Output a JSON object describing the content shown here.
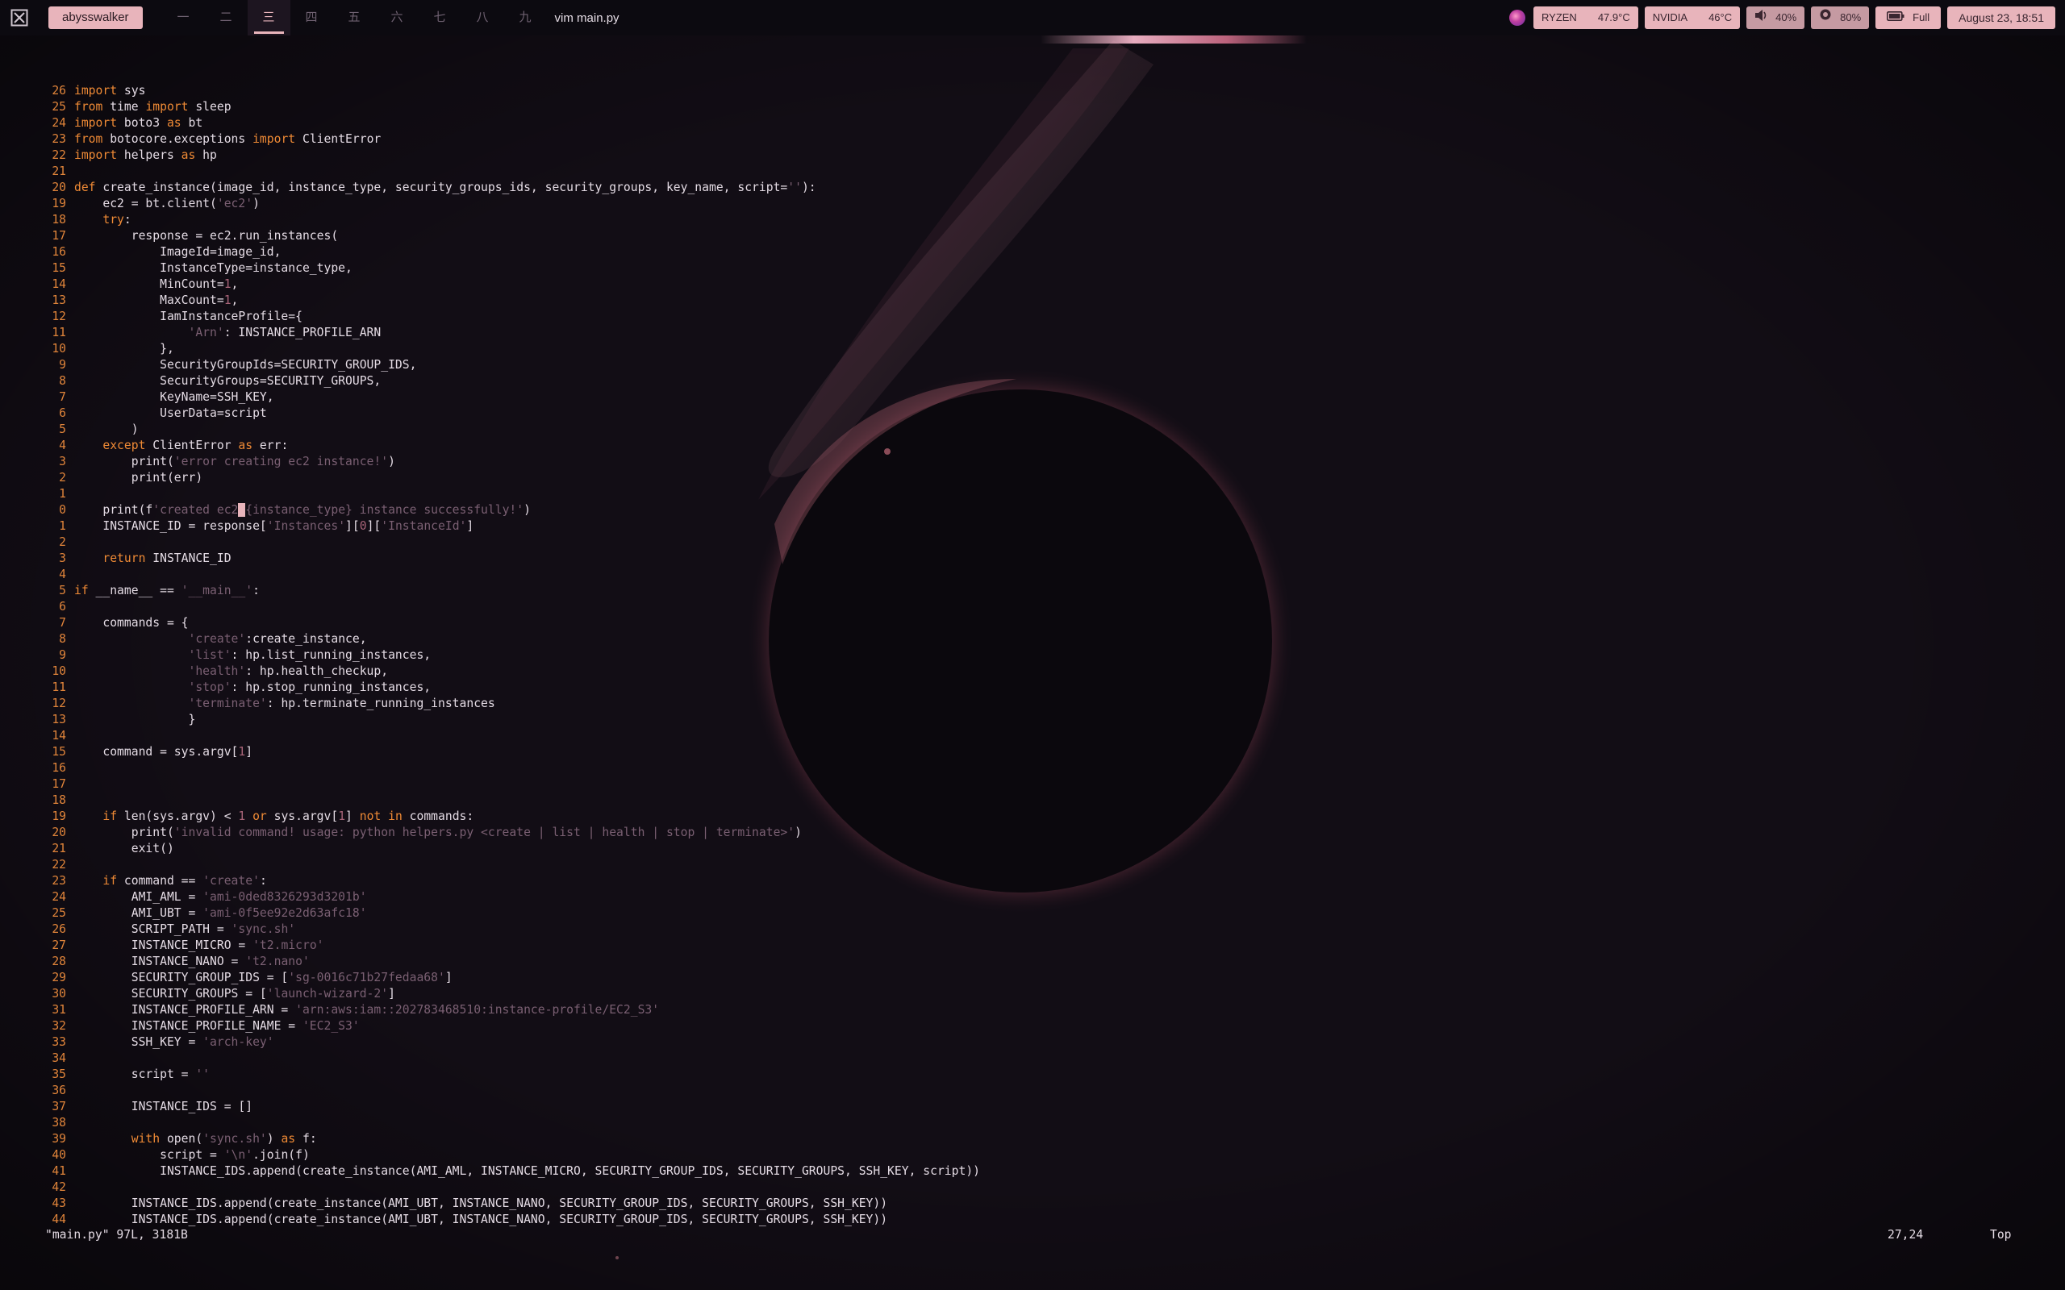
{
  "topbar": {
    "user": "abysswalker",
    "workspaces": [
      "一",
      "二",
      "三",
      "四",
      "五",
      "六",
      "七",
      "八",
      "九"
    ],
    "active_workspace": 2,
    "window_title": "vim main.py",
    "cpu_label": "RYZEN",
    "cpu_temp": "47.9°C",
    "gpu_label": "NVIDIA",
    "gpu_temp": "46°C",
    "volume": "40%",
    "brightness": "80%",
    "battery": "Full",
    "datetime": "August 23, 18:51"
  },
  "editor": {
    "lines": [
      {
        "n": "26",
        "t": "import sys"
      },
      {
        "n": "25",
        "t": "from time import sleep"
      },
      {
        "n": "24",
        "t": "import boto3 as bt"
      },
      {
        "n": "23",
        "t": "from botocore.exceptions import ClientError"
      },
      {
        "n": "22",
        "t": "import helpers as hp"
      },
      {
        "n": "21",
        "t": ""
      },
      {
        "n": "20",
        "t": "def create_instance(image_id, instance_type, security_groups_ids, security_groups, key_name, script=''):"
      },
      {
        "n": "19",
        "t": "    ec2 = bt.client('ec2')"
      },
      {
        "n": "18",
        "t": "    try:"
      },
      {
        "n": "17",
        "t": "        response = ec2.run_instances("
      },
      {
        "n": "16",
        "t": "            ImageId=image_id,"
      },
      {
        "n": "15",
        "t": "            InstanceType=instance_type,"
      },
      {
        "n": "14",
        "t": "            MinCount=1,"
      },
      {
        "n": "13",
        "t": "            MaxCount=1,"
      },
      {
        "n": "12",
        "t": "            IamInstanceProfile={"
      },
      {
        "n": "11",
        "t": "                'Arn': INSTANCE_PROFILE_ARN"
      },
      {
        "n": "10",
        "t": "            },"
      },
      {
        "n": "9",
        "t": "            SecurityGroupIds=SECURITY_GROUP_IDS,"
      },
      {
        "n": "8",
        "t": "            SecurityGroups=SECURITY_GROUPS,"
      },
      {
        "n": "7",
        "t": "            KeyName=SSH_KEY,"
      },
      {
        "n": "6",
        "t": "            UserData=script"
      },
      {
        "n": "5",
        "t": "        )"
      },
      {
        "n": "4",
        "t": "    except ClientError as err:"
      },
      {
        "n": "3",
        "t": "        print('error creating ec2 instance!')"
      },
      {
        "n": "2",
        "t": "        print(err)"
      },
      {
        "n": "1",
        "t": ""
      },
      {
        "n": "0",
        "t": "    print(f'created ec2 {instance_type} instance successfully!')"
      },
      {
        "n": "1",
        "t": "    INSTANCE_ID = response['Instances'][0]['InstanceId']"
      },
      {
        "n": "2",
        "t": ""
      },
      {
        "n": "3",
        "t": "    return INSTANCE_ID"
      },
      {
        "n": "4",
        "t": ""
      },
      {
        "n": "5",
        "t": "if __name__ == '__main__':"
      },
      {
        "n": "6",
        "t": ""
      },
      {
        "n": "7",
        "t": "    commands = {"
      },
      {
        "n": "8",
        "t": "                'create':create_instance,"
      },
      {
        "n": "9",
        "t": "                'list': hp.list_running_instances,"
      },
      {
        "n": "10",
        "t": "                'health': hp.health_checkup,"
      },
      {
        "n": "11",
        "t": "                'stop': hp.stop_running_instances,"
      },
      {
        "n": "12",
        "t": "                'terminate': hp.terminate_running_instances"
      },
      {
        "n": "13",
        "t": "                }"
      },
      {
        "n": "14",
        "t": ""
      },
      {
        "n": "15",
        "t": "    command = sys.argv[1]"
      },
      {
        "n": "16",
        "t": ""
      },
      {
        "n": "17",
        "t": ""
      },
      {
        "n": "18",
        "t": ""
      },
      {
        "n": "19",
        "t": "    if len(sys.argv) < 1 or sys.argv[1] not in commands:"
      },
      {
        "n": "20",
        "t": "        print('invalid command! usage: python helpers.py <create | list | health | stop | terminate>')"
      },
      {
        "n": "21",
        "t": "        exit()"
      },
      {
        "n": "22",
        "t": ""
      },
      {
        "n": "23",
        "t": "    if command == 'create':"
      },
      {
        "n": "24",
        "t": "        AMI_AML = 'ami-0ded8326293d3201b'"
      },
      {
        "n": "25",
        "t": "        AMI_UBT = 'ami-0f5ee92e2d63afc18'"
      },
      {
        "n": "26",
        "t": "        SCRIPT_PATH = 'sync.sh'"
      },
      {
        "n": "27",
        "t": "        INSTANCE_MICRO = 't2.micro'"
      },
      {
        "n": "28",
        "t": "        INSTANCE_NANO = 't2.nano'"
      },
      {
        "n": "29",
        "t": "        SECURITY_GROUP_IDS = ['sg-0016c71b27fedaa68']"
      },
      {
        "n": "30",
        "t": "        SECURITY_GROUPS = ['launch-wizard-2']"
      },
      {
        "n": "31",
        "t": "        INSTANCE_PROFILE_ARN = 'arn:aws:iam::202783468510:instance-profile/EC2_S3'"
      },
      {
        "n": "32",
        "t": "        INSTANCE_PROFILE_NAME = 'EC2_S3'"
      },
      {
        "n": "33",
        "t": "        SSH_KEY = 'arch-key'"
      },
      {
        "n": "34",
        "t": ""
      },
      {
        "n": "35",
        "t": "        script = ''"
      },
      {
        "n": "36",
        "t": ""
      },
      {
        "n": "37",
        "t": "        INSTANCE_IDS = []"
      },
      {
        "n": "38",
        "t": ""
      },
      {
        "n": "39",
        "t": "        with open('sync.sh') as f:"
      },
      {
        "n": "40",
        "t": "            script = '\\n'.join(f)"
      },
      {
        "n": "41",
        "t": "            INSTANCE_IDS.append(create_instance(AMI_AML, INSTANCE_MICRO, SECURITY_GROUP_IDS, SECURITY_GROUPS, SSH_KEY, script))"
      },
      {
        "n": "42",
        "t": ""
      },
      {
        "n": "43",
        "t": "        INSTANCE_IDS.append(create_instance(AMI_UBT, INSTANCE_NANO, SECURITY_GROUP_IDS, SECURITY_GROUPS, SSH_KEY))"
      },
      {
        "n": "44",
        "t": "        INSTANCE_IDS.append(create_instance(AMI_UBT, INSTANCE_NANO, SECURITY_GROUP_IDS, SECURITY_GROUPS, SSH_KEY))"
      }
    ],
    "cursor_line_index": 26,
    "cursor_col": 23
  },
  "statusline": {
    "file_info": "\"main.py\" 97L, 3181B",
    "position": "27,24",
    "scroll": "Top"
  },
  "colors": {
    "accent": "#e8b4bb",
    "line_number": "#e0843a",
    "keyword": "#ef8a35",
    "string": "#7a5f72",
    "text": "#e4dbe4",
    "background": "#0e0b12"
  }
}
